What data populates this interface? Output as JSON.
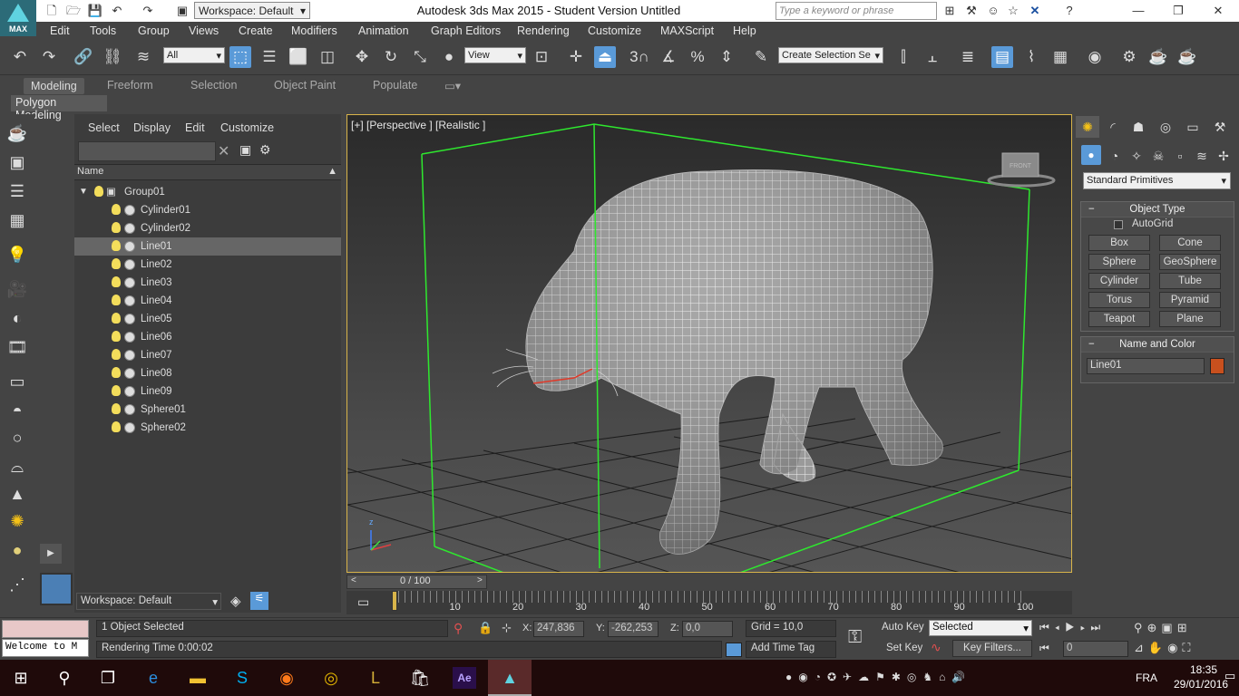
{
  "titlebar": {
    "app_title": "Autodesk 3ds Max  2015   - Student Version   Untitled",
    "logo_text": "MAX",
    "workspace": "Workspace: Default",
    "search_placeholder": "Type a keyword or phrase",
    "window_controls": [
      "minimize-icon",
      "restore-icon",
      "close-icon"
    ]
  },
  "menu": [
    "Edit",
    "Tools",
    "Group",
    "Views",
    "Create",
    "Modifiers",
    "Animation",
    "Graph Editors",
    "Rendering",
    "Customize",
    "MAXScript",
    "Help"
  ],
  "toolbar": {
    "filter": "All",
    "ref_coord": "View",
    "snap_label": "3",
    "selection_set_placeholder": "Create Selection Se"
  },
  "ribbon": {
    "tabs": [
      "Modeling",
      "Freeform",
      "Selection",
      "Object Paint",
      "Populate"
    ],
    "active_tab": "Modeling",
    "sub": "Polygon Modeling"
  },
  "explorer": {
    "menu": [
      "Select",
      "Display",
      "Edit",
      "Customize"
    ],
    "column": "Name",
    "group": "Group01",
    "items": [
      "Cylinder01",
      "Cylinder02",
      "Line01",
      "Line02",
      "Line03",
      "Line04",
      "Line05",
      "Line06",
      "Line07",
      "Line08",
      "Line09",
      "Sphere01",
      "Sphere02"
    ],
    "selected": "Line01",
    "workspace": "Workspace: Default"
  },
  "viewport": {
    "label": "[+] [Perspective ] [Realistic ]",
    "viewcube": "FRONT"
  },
  "timeline": {
    "frame": "0 / 100",
    "ticks": [
      "10",
      "20",
      "30",
      "40",
      "50",
      "60",
      "70",
      "80",
      "90",
      "100"
    ],
    "tick_values": [
      10,
      20,
      30,
      40,
      50,
      60,
      70,
      80,
      90,
      100
    ],
    "range": [
      0,
      100
    ]
  },
  "command_panel": {
    "category": "Standard Primitives",
    "object_type_title": "Object Type",
    "autogrid": "AutoGrid",
    "buttons": [
      "Box",
      "Cone",
      "Sphere",
      "GeoSphere",
      "Cylinder",
      "Tube",
      "Torus",
      "Pyramid",
      "Teapot",
      "Plane"
    ],
    "name_color_title": "Name and Color",
    "object_name": "Line01",
    "object_color": "#c8501e"
  },
  "status": {
    "listener": "Welcome to M",
    "selected": "1 Object Selected",
    "render_time": "Rendering Time  0:00:02",
    "x_label": "X:",
    "x": "247,836",
    "y_label": "Y:",
    "y": "-262,253",
    "z_label": "Z:",
    "z": "0,0",
    "grid": "Grid = 10,0",
    "add_time_tag": "Add Time Tag",
    "auto_key": "Auto Key",
    "set_key": "Set Key",
    "key_mode": "Selected",
    "key_filters": "Key Filters...",
    "frame_field": "0"
  },
  "taskbar": {
    "language": "FRA",
    "time": "18:35",
    "date": "29/01/2016"
  },
  "colors": {
    "accent": "#5a9ad8",
    "bbox": "#2ee82e",
    "viewport_border": "#d8b44a"
  }
}
